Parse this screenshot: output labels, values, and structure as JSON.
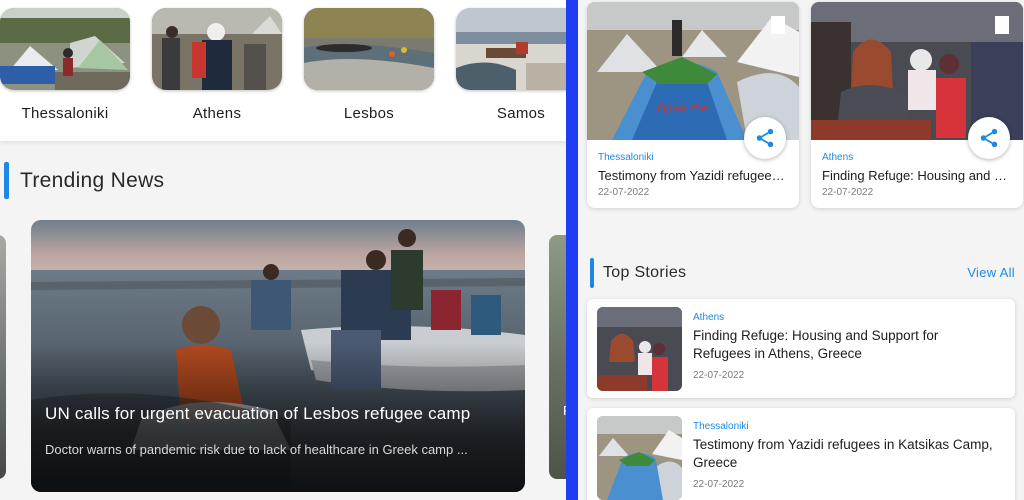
{
  "locations": [
    {
      "label": "Thessaloniki"
    },
    {
      "label": "Athens"
    },
    {
      "label": "Lesbos"
    },
    {
      "label": "Samos"
    }
  ],
  "trending": {
    "section_title": "Trending News",
    "hero": {
      "title": "UN calls for urgent evacuation of Lesbos refugee camp",
      "subtitle": "Doctor warns of pandemic risk due to lack of healthcare in Greek camp ..."
    },
    "peek_letter": "F"
  },
  "latest_cards": [
    {
      "category": "Thessaloniki",
      "title": "Testimony from Yazidi refugees in Katsikas Camp, Greece",
      "date": "22-07-2022"
    },
    {
      "category": "Athens",
      "title": "Finding Refuge: Housing and Support for Refugees in Athens, Greece",
      "date": "22-07-2022"
    }
  ],
  "top_stories": {
    "section_title": "Top Stories",
    "view_all": "View All",
    "items": [
      {
        "category": "Athens",
        "title": "Finding Refuge: Housing and Support for Refugees in Athens, Greece",
        "date": "22-07-2022"
      },
      {
        "category": "Thessaloniki",
        "title": "Testimony from Yazidi refugees in Katsikas Camp, Greece",
        "date": "22-07-2022"
      }
    ]
  },
  "colors": {
    "accent": "#1e88e5",
    "divider": "#1f3df2"
  },
  "icons": {
    "share": "share-icon",
    "bookmark": "bookmark-icon"
  }
}
